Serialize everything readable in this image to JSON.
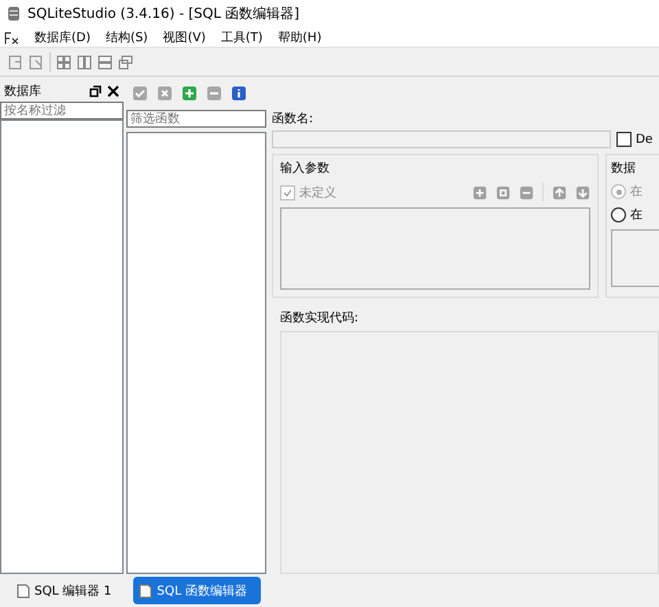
{
  "window": {
    "title": "SQLiteStudio (3.4.16) - [SQL 函数编辑器]"
  },
  "menu": [
    "数据库(D)",
    "结构(S)",
    "视图(V)",
    "工具(T)",
    "帮助(H)"
  ],
  "database_panel": {
    "title": "数据库",
    "filter": {
      "placeholder": "按名称过滤"
    }
  },
  "function_toolbar": [
    {
      "kind": "commit",
      "disabled": true
    },
    {
      "kind": "rollback",
      "disabled": true
    },
    {
      "kind": "add",
      "disabled": false
    },
    {
      "kind": "remove",
      "disabled": true
    },
    {
      "kind": "info",
      "disabled": false
    }
  ],
  "function_filter": {
    "placeholder": "筛选函数"
  },
  "function_name": {
    "label": "函数名:"
  },
  "deterministic": {
    "label": "De",
    "checked": false
  },
  "input_params": {
    "title": "输入参数",
    "undefined_check": {
      "label": "未定义",
      "checked": true,
      "disabled": true
    }
  },
  "databases_group": {
    "title": "数据",
    "options": [
      {
        "label": "在",
        "selected": true,
        "disabled": true
      },
      {
        "label": "在",
        "selected": false,
        "disabled": false
      }
    ]
  },
  "code": {
    "label": "函数实现代码:"
  },
  "taskbar": [
    {
      "label": "SQL 编辑器 1",
      "selected": false
    },
    {
      "label": "SQL 函数编辑器",
      "selected": true
    }
  ]
}
